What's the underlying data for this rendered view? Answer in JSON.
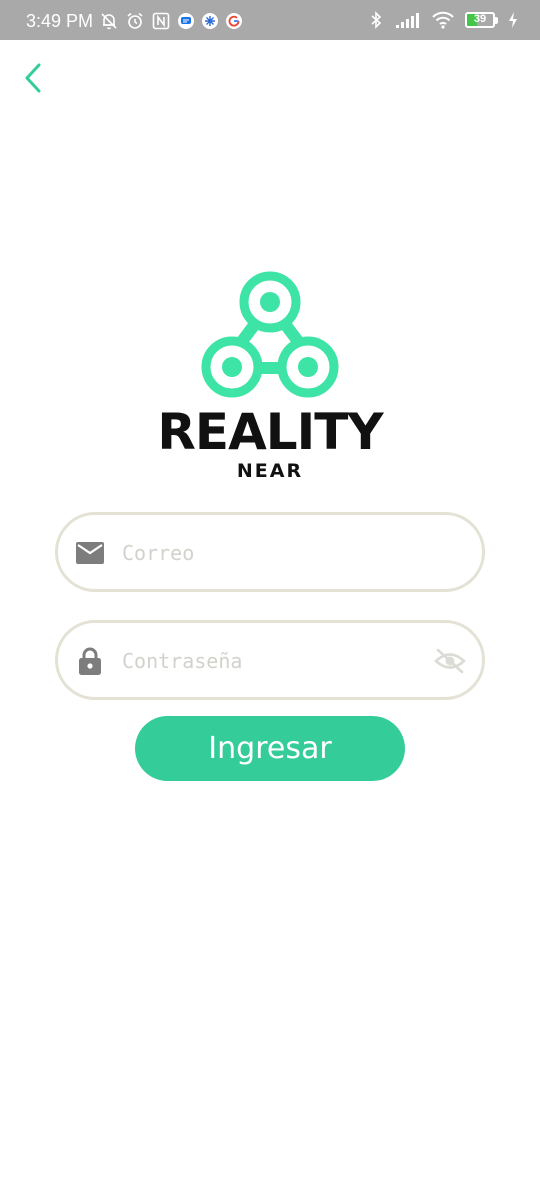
{
  "status_bar": {
    "time": "3:49 PM",
    "battery_level": "39",
    "battery_fraction": 0.39,
    "icons": [
      "mute-bell-icon",
      "alarm-icon",
      "nfc-icon",
      "messages-icon",
      "assistant-icon",
      "google-icon",
      "bluetooth-icon",
      "signal-icon",
      "wifi-icon",
      "battery-icon",
      "charging-icon"
    ]
  },
  "header": {
    "back_icon": "chevron-left-icon"
  },
  "logo": {
    "wordmark": "REALITY",
    "subtitle": "NEAR"
  },
  "form": {
    "email": {
      "placeholder": "Correo",
      "value": "",
      "icon": "envelope-icon"
    },
    "password": {
      "placeholder": "Contraseña",
      "value": "",
      "icon": "lock-icon",
      "toggle_icon": "eye-off-icon"
    },
    "submit_label": "Ingresar"
  },
  "colors": {
    "accent": "#34cc98",
    "logo_green": "#3ee3a6",
    "status_bar": "#a9a9a9",
    "field_border": "#e4e2d5",
    "icon_gray": "#7d7d7d",
    "placeholder": "#d2d2cc"
  }
}
